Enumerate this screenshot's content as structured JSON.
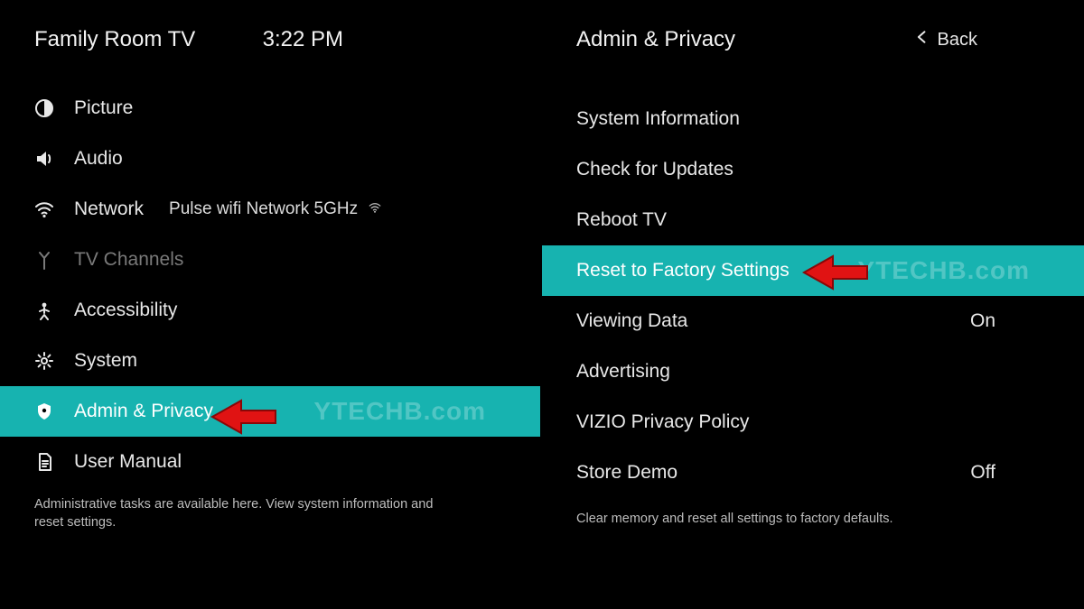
{
  "left": {
    "header": {
      "title": "Family Room TV",
      "time": "3:22 PM"
    },
    "items": [
      {
        "icon": "contrast",
        "label": "Picture"
      },
      {
        "icon": "speaker",
        "label": "Audio"
      },
      {
        "icon": "wifi",
        "label": "Network",
        "extra": "Pulse wifi Network 5GHz"
      },
      {
        "icon": "antenna",
        "label": "TV Channels",
        "disabled": true
      },
      {
        "icon": "person",
        "label": "Accessibility"
      },
      {
        "icon": "gear",
        "label": "System"
      },
      {
        "icon": "shield",
        "label": "Admin & Privacy",
        "selected": true
      },
      {
        "icon": "doc",
        "label": "User Manual"
      }
    ],
    "hint": "Administrative tasks are available here. View system information and reset settings.",
    "watermark": "YTECHB.com"
  },
  "right": {
    "header": {
      "title": "Admin & Privacy",
      "back": "Back"
    },
    "items": [
      {
        "label": "System Information"
      },
      {
        "label": "Check for Updates"
      },
      {
        "label": "Reboot TV"
      },
      {
        "label": "Reset to Factory Settings",
        "selected": true
      },
      {
        "label": "Viewing Data",
        "value": "On"
      },
      {
        "label": "Advertising"
      },
      {
        "label": "VIZIO Privacy Policy"
      },
      {
        "label": "Store Demo",
        "value": "Off"
      }
    ],
    "hint": "Clear memory and reset all settings to factory defaults.",
    "watermark": "YTECHB.com"
  },
  "colors": {
    "accent": "#17b3b0",
    "arrow": "#e01313"
  }
}
